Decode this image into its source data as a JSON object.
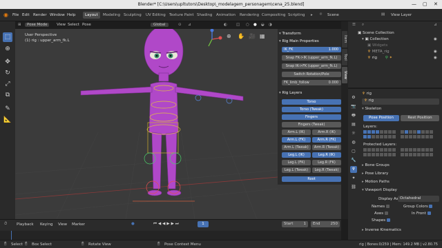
{
  "window": {
    "title": "Blender* [C:\\Users\\upltutors\\Desktop\\_modelagem_personagem\\cena_25.blend]"
  },
  "menu": [
    "File",
    "Edit",
    "Render",
    "Window",
    "Help"
  ],
  "workspaces": [
    "Layout",
    "Modeling",
    "Sculpting",
    "UV Editing",
    "Texture Paint",
    "Shading",
    "Animation",
    "Rendering",
    "Compositing",
    "Scripting"
  ],
  "scene": "Scene",
  "view_layer": "View Layer",
  "viewport": {
    "mode": "Pose Mode",
    "menus": [
      "View",
      "Select",
      "Pose"
    ],
    "orientation": "Global",
    "overlay_title": "User Perspective",
    "overlay_sub": "(1) rig : upper_arm_fk.L"
  },
  "npanel": {
    "tabs": [
      "Item",
      "Tool",
      "View"
    ],
    "transform": "Transform",
    "main_props": "Rig Main Properties",
    "ik_fk_label": "IK_FK",
    "ik_fk_value": "1.000",
    "snap1": "Snap FK->IK (upper_arm_fk.L)",
    "snap2": "Snap IK->FK (upper_arm_fk.L)",
    "switch_rot": "Switch Rotation/Pole",
    "fk_limb_label": "FK_limb_follow",
    "fk_limb_value": "0.000",
    "rig_layers": "Rig Layers",
    "layers": {
      "torso": "Torso",
      "torso_tweak": "Torso (Tweak)",
      "fingers": "Fingers",
      "fingers_tweak": "Fingers (Tweak)",
      "arm_l_ik": "Arm.L (IK)",
      "arm_r_ik": "Arm.R (IK)",
      "arm_l_fk": "Arm.L (FK)",
      "arm_r_fk": "Arm.R (FK)",
      "arm_l_tweak": "Arm.L (Tweak)",
      "arm_r_tweak": "Arm.R (Tweak)",
      "leg_l_ik": "Leg.L (IK)",
      "leg_r_ik": "Leg.R (IK)",
      "leg_l_fk": "Leg.L (FK)",
      "leg_r_fk": "Leg.R (FK)",
      "leg_l_tweak": "Leg.L (Tweak)",
      "leg_r_tweak": "Leg.R (Tweak)",
      "root": "Root"
    }
  },
  "outliner": {
    "items": [
      {
        "label": "Scene Collection"
      },
      {
        "label": "Collection"
      },
      {
        "label": "Widgets"
      },
      {
        "label": "META_rig"
      },
      {
        "label": "rig"
      }
    ]
  },
  "properties": {
    "object": "rig",
    "data": "rig",
    "skeleton": "Skeleton",
    "pose_position": "Pose Position",
    "rest_position": "Rest Position",
    "layers": "Layers:",
    "protected_layers": "Protected Layers:",
    "sections": [
      "Bone Groups",
      "Pose Library",
      "Motion Paths",
      "Viewport Display"
    ],
    "display_as_label": "Display As",
    "display_as_value": "Octahedral",
    "names": "Names",
    "axes": "Axes",
    "shapes": "Shapes",
    "group_colors": "Group Colors",
    "in_front": "In Front",
    "inverse_kinematics": "Inverse Kinematics"
  },
  "timeline": {
    "menus": [
      "Playback",
      "Keying",
      "View",
      "Marker"
    ],
    "current_frame": "1",
    "start_label": "Start",
    "start_value": "1",
    "end_label": "End",
    "end_value": "250"
  },
  "status": {
    "select": "Select",
    "box_select": "Box Select",
    "rotate_view": "Rotate View",
    "context_menu": "Pose Context Menu",
    "stats": "rig | Bones:0/259 | Mem: 149.2 MB | v2.80.75"
  },
  "colors": {
    "accent": "#4772b3",
    "character": "#b048c8"
  }
}
